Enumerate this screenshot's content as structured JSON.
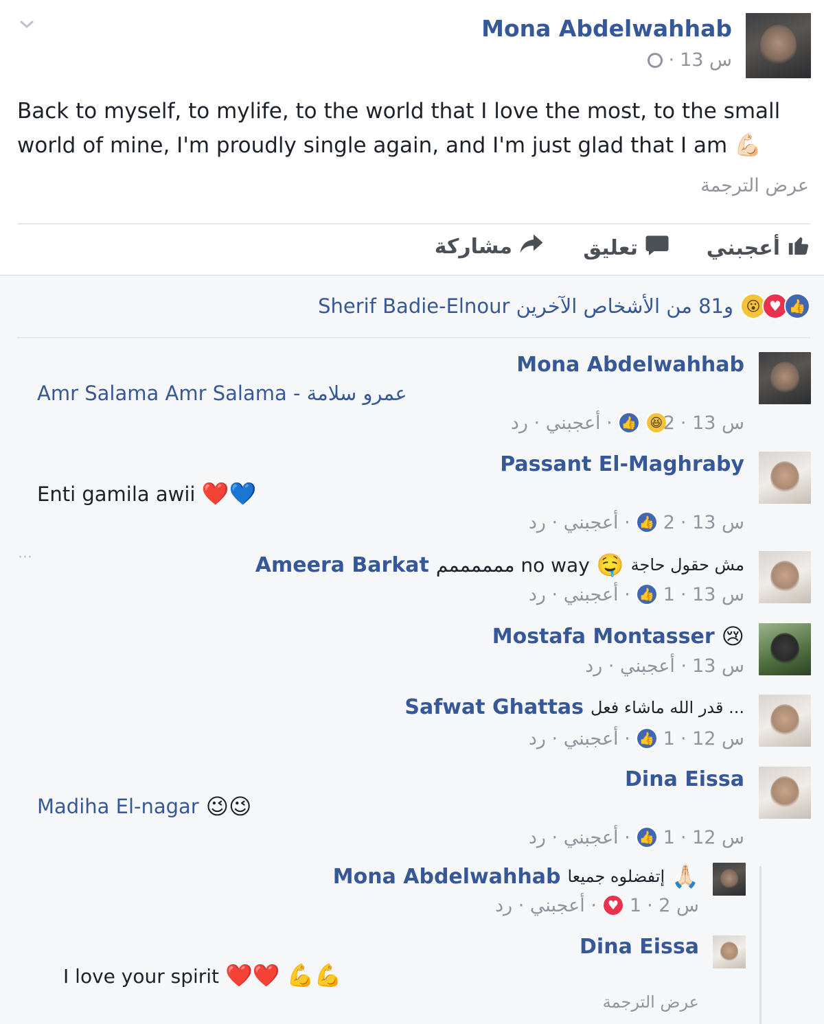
{
  "post": {
    "author": "Mona Abdelwahhab",
    "time": "13 س",
    "privacy_icon": "globe-icon",
    "text_line1": "Back to myself, to mylife, to the world that I love the most, to the small",
    "text_line2": "world of mine, I'm proudly single again, and I'm just glad that I am",
    "text_emoji": "💪🏻",
    "see_translation": "عرض الترجمة"
  },
  "actions": {
    "like": "أعجبني",
    "comment": "تعليق",
    "share": "مشاركة"
  },
  "reactions_summary": {
    "text": "Sherif Badie-Elnour و81 من الأشخاص الآخرين"
  },
  "comments": [
    {
      "author": "Mona Abdelwahhab",
      "text": "Amr Salama Amr Salama - عمرو سلامة",
      "actions": "أعجبني · رد ·",
      "reaction_count": "2",
      "time": "· 13 س"
    },
    {
      "author": "Passant El-Maghraby",
      "text": "Enti gamila awii",
      "emoji": "❤️💙",
      "actions": "أعجبني · رد ·",
      "reaction_count": "2",
      "time": "· 13 س"
    },
    {
      "author": "Ameera Barkat",
      "text_a": "ممممممم no way",
      "emoji": "🤤",
      "text_b": "مش حقول حاجة",
      "actions": "أعجبني · رد ·",
      "reaction_count": "1",
      "time": "· 13 س",
      "more": "···"
    },
    {
      "author": "Mostafa Montasser",
      "emoji": "😢",
      "actions": "أعجبني · رد ·",
      "time": "13 س"
    },
    {
      "author": "Safwat Ghattas",
      "text": "قدر الله ماشاء فعل ...",
      "actions": "أعجبني · رد ·",
      "reaction_count": "1",
      "time": "· 12 س"
    },
    {
      "author": "Dina Eissa",
      "text": "Madiha El-nagar",
      "emoji": "😉😉",
      "actions": "أعجبني · رد ·",
      "reaction_count": "1",
      "time": "· 12 س"
    }
  ],
  "replies": [
    {
      "author": "Mona Abdelwahhab",
      "text": "إتفضلوه جميعا",
      "emoji": "🙏🏻",
      "actions": "أعجبني · رد ·",
      "reaction_count": "1",
      "time": "· 2 س"
    },
    {
      "author": "Dina Eissa",
      "text": "I love your spirit",
      "emoji": "❤️❤️ 💪💪",
      "see_translation": "عرض الترجمة"
    }
  ],
  "colors": {
    "name": "#365899",
    "meta": "#90949c",
    "like_blue": "#4267b2",
    "love_red": "#e9324d"
  }
}
